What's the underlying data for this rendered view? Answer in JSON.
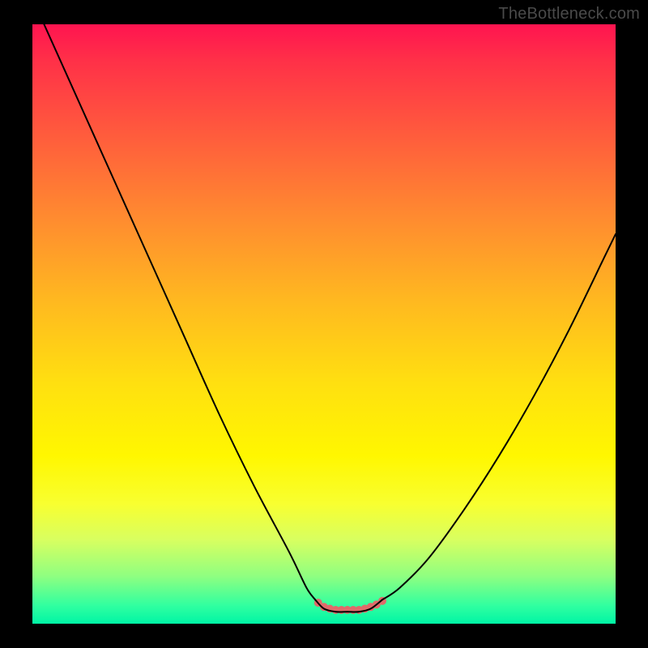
{
  "attribution": "TheBottleneck.com",
  "chart_data": {
    "type": "line",
    "title": "",
    "xlabel": "",
    "ylabel": "",
    "xlim": [
      0,
      100
    ],
    "ylim": [
      0,
      100
    ],
    "series": [
      {
        "name": "left-curve",
        "x": [
          2,
          8,
          14,
          20,
          26,
          32,
          38,
          44,
          47,
          48.5
        ],
        "values": [
          100,
          87,
          74,
          61,
          48,
          35,
          23,
          12,
          6,
          4
        ]
      },
      {
        "name": "right-curve",
        "x": [
          60,
          63,
          68,
          74,
          80,
          86,
          92,
          98,
          100
        ],
        "values": [
          4,
          6,
          11,
          19,
          28,
          38,
          49,
          61,
          65
        ]
      },
      {
        "name": "bottom-flat",
        "x": [
          48.5,
          50,
          52,
          54,
          56,
          58,
          60
        ],
        "values": [
          4,
          2.5,
          2,
          2,
          2,
          2.5,
          4
        ]
      }
    ],
    "bottom_dots": {
      "x": [
        49,
        50,
        51,
        52,
        53,
        54,
        55,
        56,
        57,
        58,
        59,
        60
      ],
      "y": [
        3.5,
        2.8,
        2.5,
        2.3,
        2.3,
        2.3,
        2.3,
        2.3,
        2.5,
        2.8,
        3.2,
        3.8
      ],
      "color": "#e06a6a",
      "radius": 5
    },
    "colors": {
      "line": "#000000",
      "gradient_top": "#ff1450",
      "gradient_bottom": "#00f5a5"
    }
  }
}
